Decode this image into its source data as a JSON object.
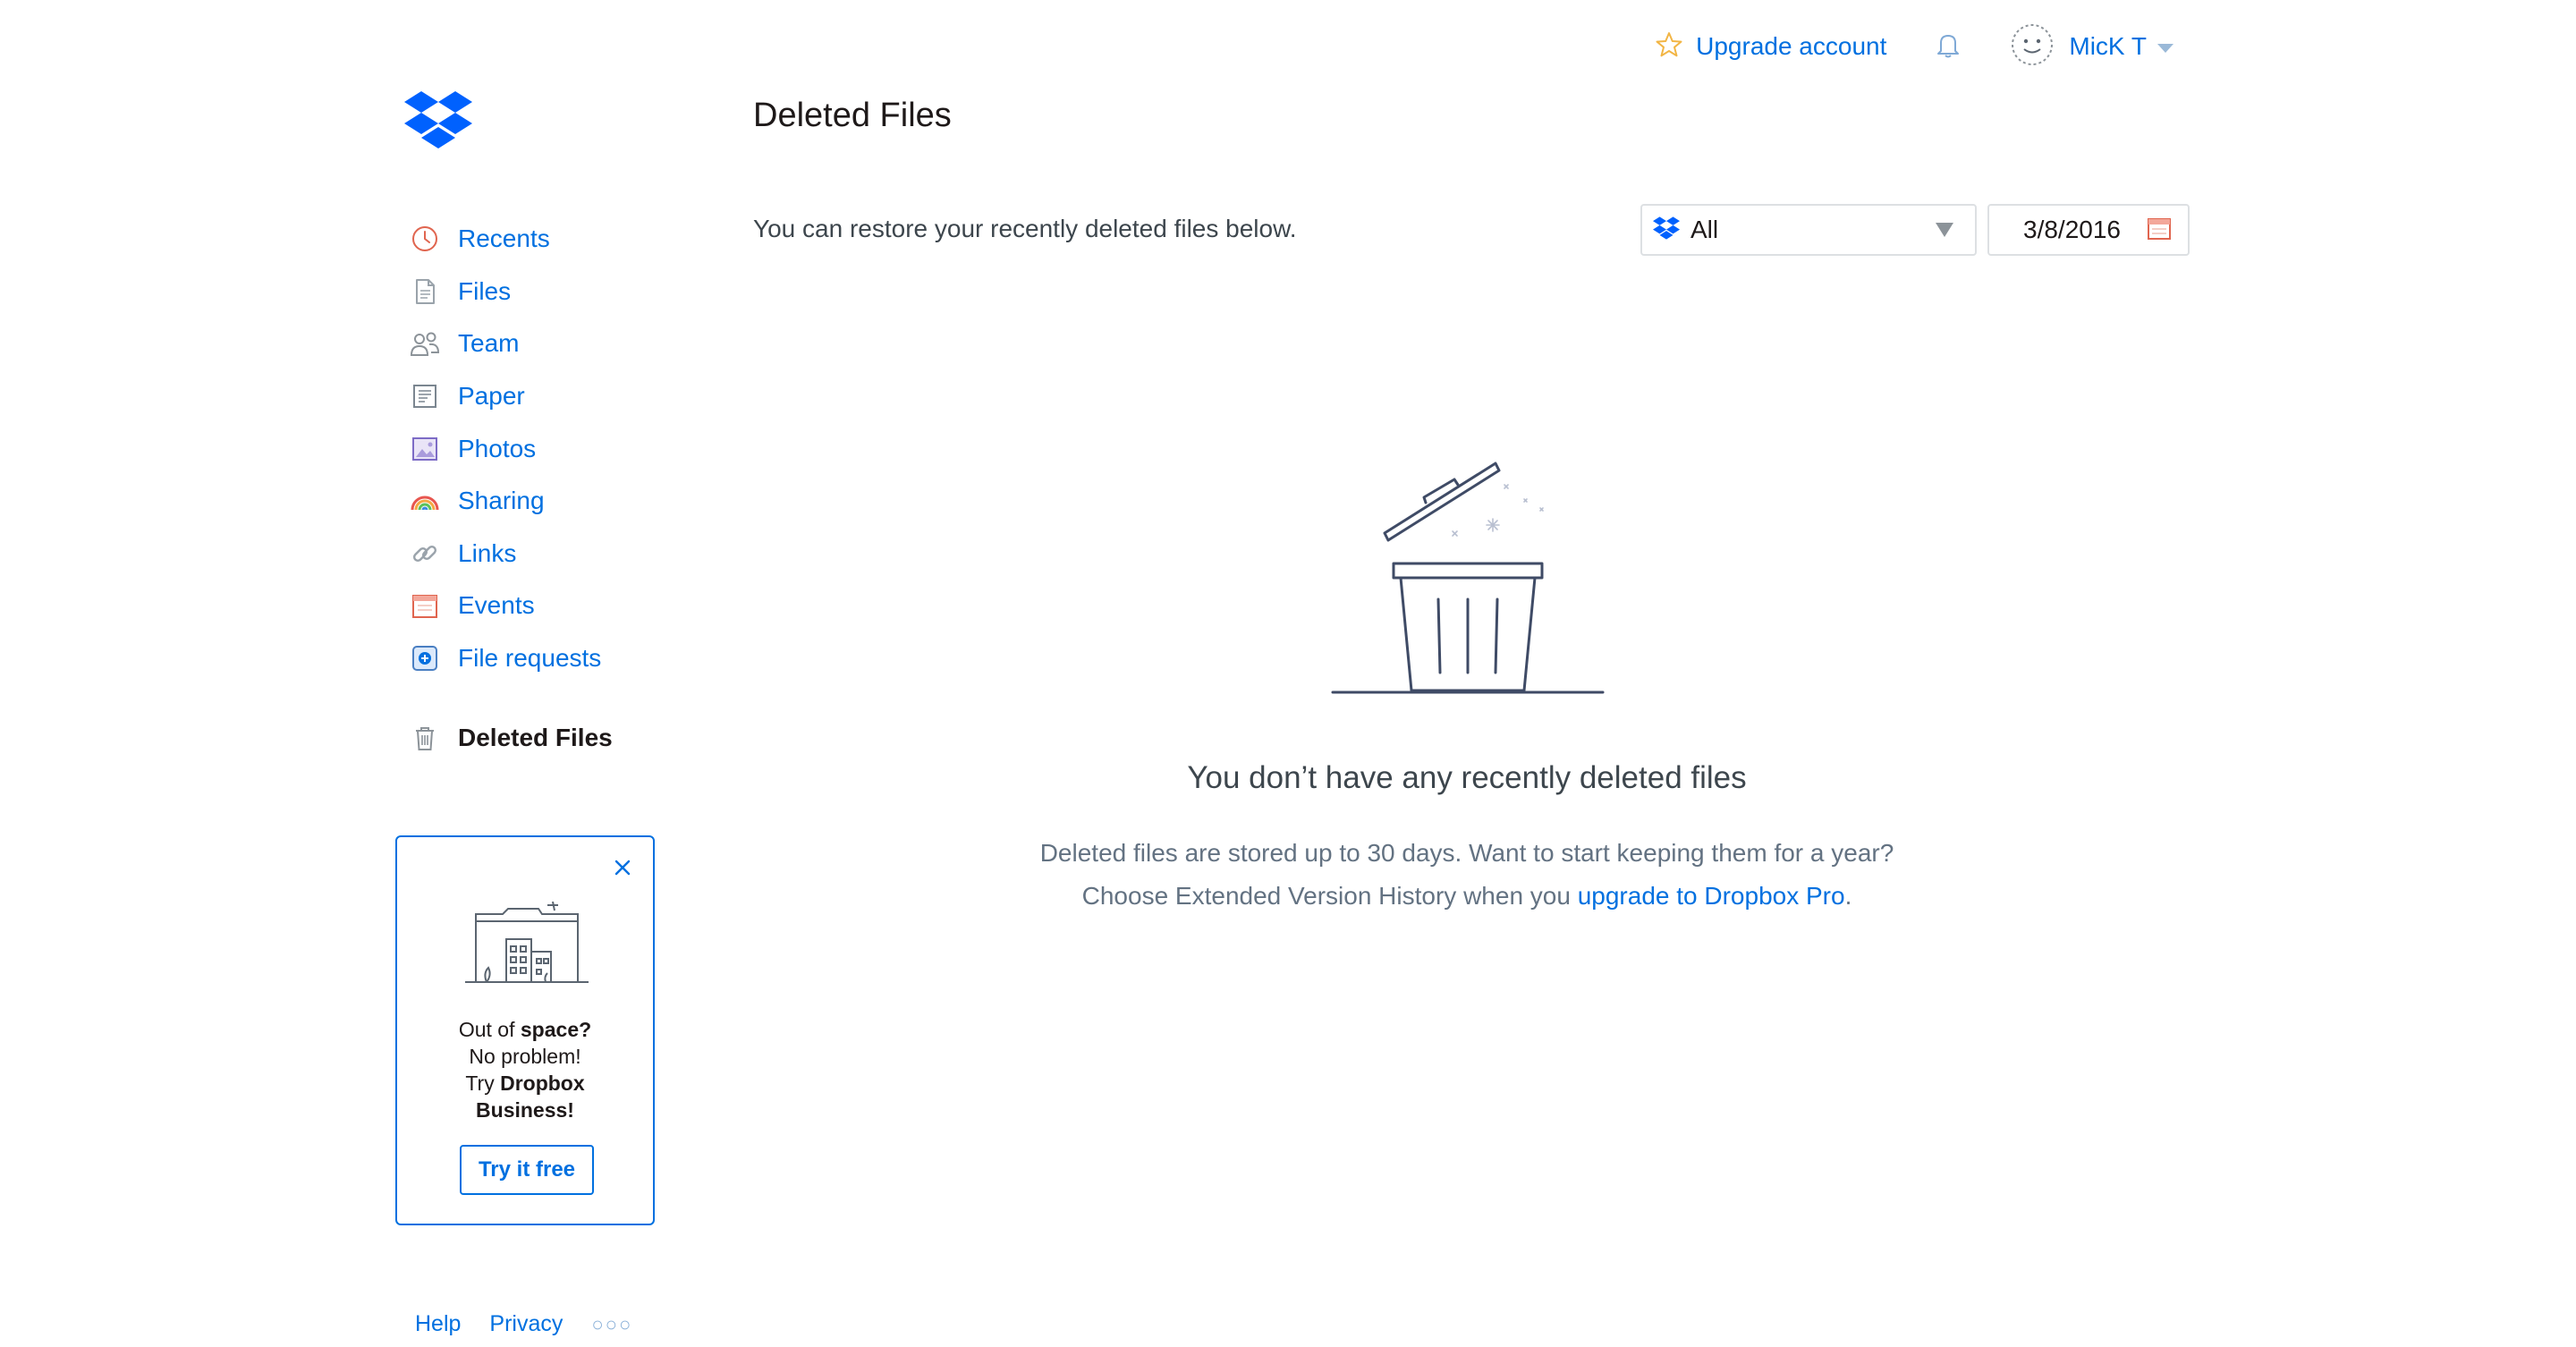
{
  "header": {
    "upgrade_label": "Upgrade account",
    "user_name": "MicK T"
  },
  "sidebar": {
    "items": [
      {
        "label": "Recents",
        "icon": "clock-icon"
      },
      {
        "label": "Files",
        "icon": "file-icon"
      },
      {
        "label": "Team",
        "icon": "team-icon"
      },
      {
        "label": "Paper",
        "icon": "paper-icon"
      },
      {
        "label": "Photos",
        "icon": "photos-icon"
      },
      {
        "label": "Sharing",
        "icon": "sharing-icon"
      },
      {
        "label": "Links",
        "icon": "link-icon"
      },
      {
        "label": "Events",
        "icon": "calendar-icon"
      },
      {
        "label": "File requests",
        "icon": "file-request-icon"
      }
    ],
    "active_item": {
      "label": "Deleted Files",
      "icon": "trash-icon"
    }
  },
  "promo": {
    "line1_prefix": "Out of ",
    "line1_bold": "space?",
    "line2": "No problem!",
    "line3_prefix": "Try ",
    "line3_bold": "Dropbox",
    "line4_bold": "Business!",
    "button_label": "Try it free"
  },
  "footer": {
    "help": "Help",
    "privacy": "Privacy",
    "more": "○○○"
  },
  "main": {
    "title": "Deleted Files",
    "subtitle": "You can restore your recently deleted files below.",
    "filter": {
      "selected": "All"
    },
    "date": {
      "value": "3/8/2016"
    },
    "empty_title": "You don’t have any recently deleted files",
    "empty_desc_line1": "Deleted files are stored up to 30 days. Want to start keeping them for a year?",
    "empty_desc_line2_prefix": "Choose Extended Version History when you ",
    "empty_desc_link": "upgrade to Dropbox Pro",
    "empty_desc_suffix": "."
  },
  "colors": {
    "accent": "#0070e0",
    "text_dark": "#1e1919",
    "text_muted": "#637282",
    "border": "#dde0e3"
  }
}
